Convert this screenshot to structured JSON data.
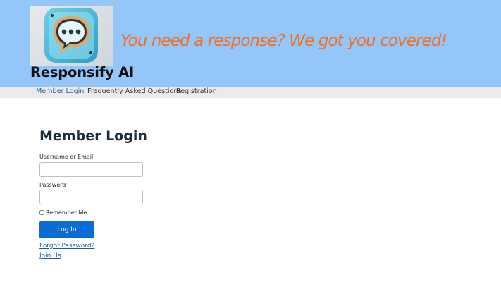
{
  "header": {
    "site_title": "Responsify AI",
    "tagline": "You need a response? We got you covered!",
    "logo_icon": "chat-bubble-icon",
    "background_color": "#94c6fa",
    "tagline_color": "#f2701d"
  },
  "nav": {
    "items": [
      {
        "label": "Member Login",
        "active": true
      },
      {
        "label": "Frequently Asked Questions",
        "active": false
      },
      {
        "label": "Registration",
        "active": false
      }
    ]
  },
  "login": {
    "title": "Member Login",
    "username_label": "Username or Email",
    "username_value": "",
    "password_label": "Password",
    "password_value": "",
    "remember_label": "Remember Me",
    "remember_checked": false,
    "submit_label": "Log In",
    "forgot_label": "Forgot Password?",
    "join_label": "Join Us",
    "button_color": "#0b6cd4"
  }
}
